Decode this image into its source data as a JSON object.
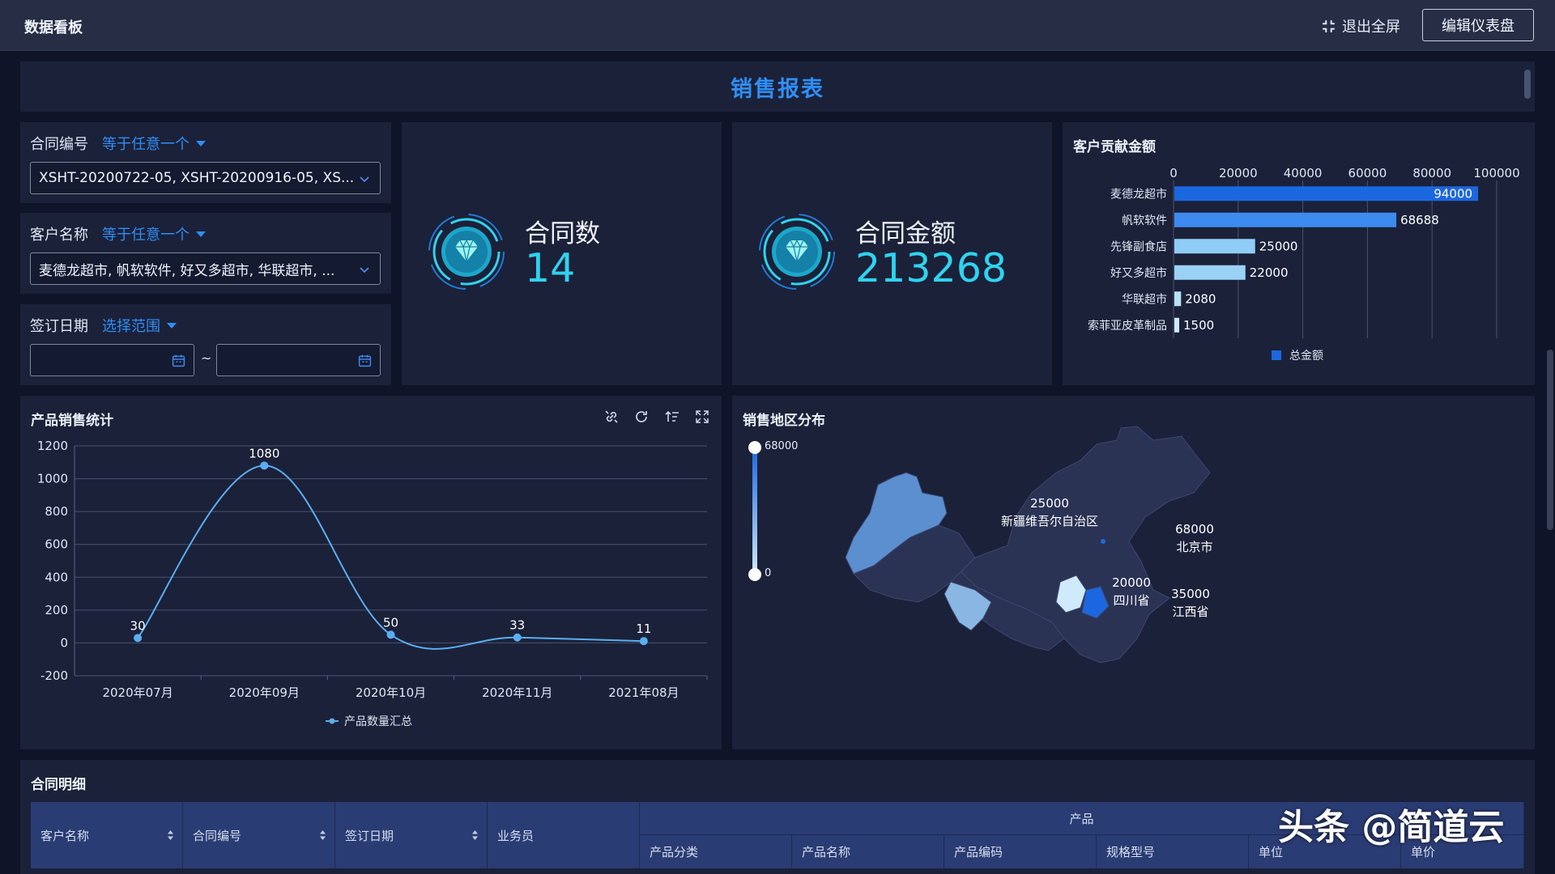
{
  "app": {
    "title": "数据看板",
    "exit_fullscreen": "退出全屏",
    "edit_dashboard": "编辑仪表盘"
  },
  "report": {
    "title": "销售报表"
  },
  "filters": {
    "contract_no": {
      "label": "合同编号",
      "op": "等于任意一个",
      "value": "XSHT-20200722-05, XSHT-20200916-05, XS..."
    },
    "customer": {
      "label": "客户名称",
      "op": "等于任意一个",
      "value": "麦德龙超市, 帆软软件, 好又多超市, 华联超市, ..."
    },
    "sign_date": {
      "label": "签订日期",
      "op": "选择范围",
      "separator": "~",
      "start": "",
      "end": ""
    }
  },
  "kpis": [
    {
      "label": "合同数",
      "value": "14"
    },
    {
      "label": "合同金额",
      "value": "213268"
    }
  ],
  "customer_chart": {
    "title": "客户贡献金额",
    "legend": "总金额",
    "color": "#1b67e0",
    "chart_data": {
      "type": "bar",
      "orientation": "horizontal",
      "categories": [
        "麦德龙超市",
        "帆软软件",
        "先锋副食店",
        "好又多超市",
        "华联超市",
        "索菲亚皮革制品"
      ],
      "values": [
        94000,
        68688,
        25000,
        22000,
        2080,
        1500
      ],
      "xlim": [
        0,
        100000
      ],
      "xticks": [
        "0",
        "20000",
        "40000",
        "60000",
        "80000",
        "100000"
      ],
      "colors": [
        "#1b67e0",
        "#3d8bf0",
        "#8fcdf6",
        "#9ad2f5",
        "#b9e1f8",
        "#cfeafb"
      ],
      "series": [
        {
          "name": "总金额"
        }
      ],
      "legend_position": "bottom"
    }
  },
  "product_chart": {
    "title": "产品销售统计",
    "legend": "产品数量汇总",
    "tools": [
      "link-icon",
      "refresh-icon",
      "sort-icon",
      "fullscreen-icon"
    ],
    "chart_data": {
      "type": "line",
      "categories": [
        "2020年07月",
        "2020年09月",
        "2020年10月",
        "2020年11月",
        "2021年08月"
      ],
      "series": [
        {
          "name": "产品数量汇总",
          "values": [
            30,
            1080,
            50,
            33,
            11
          ]
        }
      ],
      "ylim": [
        -200,
        1200
      ],
      "yticks": [
        "1200",
        "1000",
        "800",
        "600",
        "400",
        "200",
        "0",
        "-200"
      ],
      "color": "#5aaef0",
      "grid": true,
      "legend_position": "bottom"
    }
  },
  "region_chart": {
    "title": "销售地区分布",
    "range_max": "68000",
    "range_min": "0",
    "regions": [
      {
        "value": "25000",
        "name": "新疆维吾尔自治区"
      },
      {
        "value": "68000",
        "name": "北京市"
      },
      {
        "value": "20000",
        "name": "四川省"
      },
      {
        "value": "35000",
        "name": "江西省"
      }
    ]
  },
  "detail_table": {
    "title": "合同明细",
    "group_header": "产品",
    "columns": [
      "客户名称",
      "合同编号",
      "签订日期",
      "业务员"
    ],
    "sub_columns": [
      "产品分类",
      "产品名称",
      "产品编码",
      "规格型号",
      "单位",
      "单价"
    ]
  },
  "watermark": "头条 @简道云"
}
